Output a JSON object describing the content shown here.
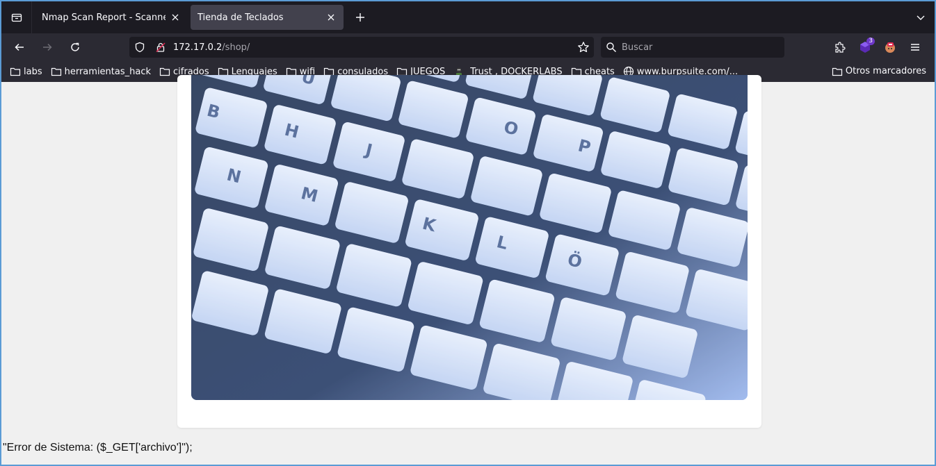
{
  "tabs": [
    {
      "title": "Nmap Scan Report - Scanned at M",
      "active": false
    },
    {
      "title": "Tienda de Teclados",
      "active": true
    }
  ],
  "urlbar": {
    "host": "172.17.0.2",
    "path": "/shop/"
  },
  "search": {
    "placeholder": "Buscar"
  },
  "extensions_badge": "3",
  "bookmarks": [
    {
      "label": "labs",
      "icon": "folder-icon"
    },
    {
      "label": "herramientas_hack",
      "icon": "folder-icon"
    },
    {
      "label": "cifrados",
      "icon": "folder-icon"
    },
    {
      "label": "Lenguajes",
      "icon": "folder-icon"
    },
    {
      "label": "wifi",
      "icon": "folder-icon"
    },
    {
      "label": "consulados",
      "icon": "folder-icon"
    },
    {
      "label": "JUEGOS",
      "icon": "folder-icon"
    },
    {
      "label": "Trust , DOCKERLABS",
      "icon": "site-icon"
    },
    {
      "label": "cheats",
      "icon": "folder-icon"
    },
    {
      "label": "www.burpsuite.com/...",
      "icon": "globe-icon"
    }
  ],
  "other_bookmarks": "Otros marcadores",
  "page": {
    "error_message": "\"Error de Sistema: ($_GET['archivo']\");"
  },
  "colors": {
    "tab_strip": "#1c1b22",
    "toolbar": "#2b2a33",
    "active_tab": "#42414d",
    "page_bg": "#f0f0f0"
  }
}
